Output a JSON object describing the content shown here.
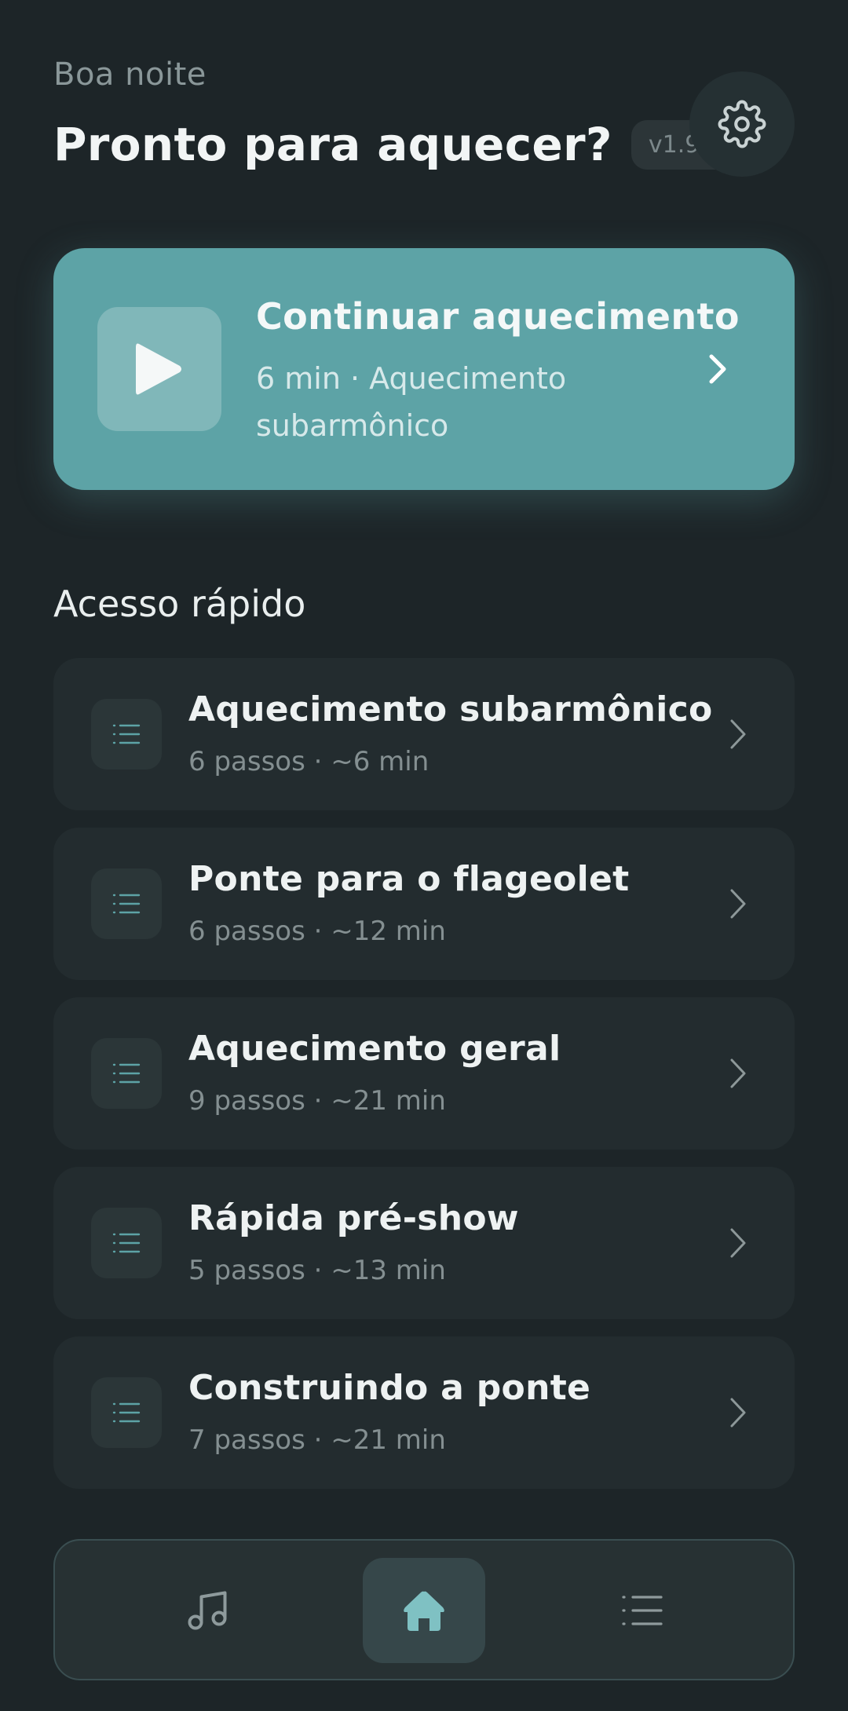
{
  "header": {
    "greeting": "Boa noite",
    "title": "Pronto para aquecer?",
    "version": "v1.9.0",
    "settings_icon": "gear-icon"
  },
  "continue_card": {
    "title": "Continuar aquecimento",
    "subtitle": "6 min · Aquecimento subarmônico",
    "play_icon": "play-icon",
    "accent_color": "#5da3a6"
  },
  "quick_access": {
    "section_title": "Acesso rápido",
    "items": [
      {
        "title": "Aquecimento subarmônico",
        "meta": "6 passos · ~6 min"
      },
      {
        "title": "Ponte para o flageolet",
        "meta": "6 passos · ~12 min"
      },
      {
        "title": "Aquecimento geral",
        "meta": "9 passos · ~21 min"
      },
      {
        "title": "Rápida pré-show",
        "meta": "5 passos · ~13 min"
      },
      {
        "title": "Construindo a ponte",
        "meta": "7 passos · ~21 min"
      }
    ]
  },
  "bottom_nav": {
    "items": [
      {
        "icon": "music-note-icon",
        "active": false
      },
      {
        "icon": "home-icon",
        "active": true
      },
      {
        "icon": "list-icon",
        "active": false
      }
    ]
  }
}
